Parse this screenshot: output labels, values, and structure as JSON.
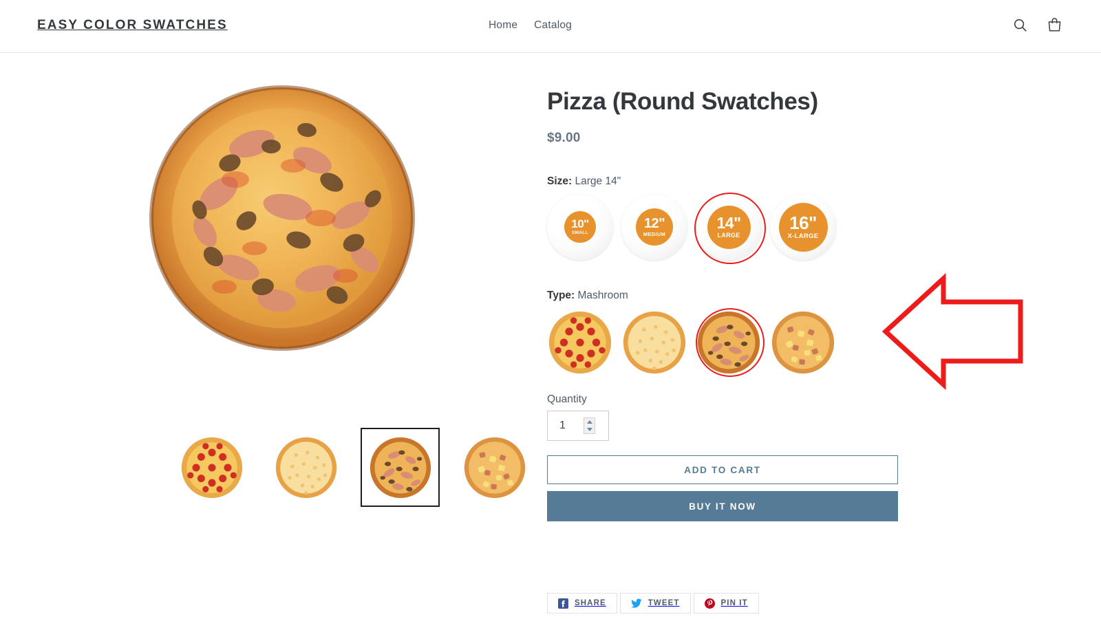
{
  "header": {
    "brand": "EASY COLOR SWATCHES",
    "nav": [
      {
        "label": "Home",
        "name": "nav-link-home"
      },
      {
        "label": "Catalog",
        "name": "nav-link-catalog"
      }
    ],
    "icons": [
      {
        "name": "search-icon",
        "label": "Search"
      },
      {
        "name": "cart-icon",
        "label": "Cart"
      }
    ]
  },
  "product": {
    "title": "Pizza (Round Swatches)",
    "price": "$9.00",
    "featured_image_alt": "Mushroom and ham pizza",
    "thumbnails": [
      {
        "alt": "Pepperoni pizza",
        "selected": false
      },
      {
        "alt": "Cheese pizza",
        "selected": false
      },
      {
        "alt": "Mushroom pizza",
        "selected": true
      },
      {
        "alt": "Hawaiian pizza",
        "selected": false
      }
    ]
  },
  "options": {
    "size": {
      "label": "Size:",
      "selected_value": "Large 14\"",
      "swatches": [
        {
          "number": "10\"",
          "caption": "SMALL",
          "selected": false
        },
        {
          "number": "12\"",
          "caption": "MEDIUM",
          "selected": false
        },
        {
          "number": "14\"",
          "caption": "LARGE",
          "selected": true
        },
        {
          "number": "16\"",
          "caption": "X-LARGE",
          "selected": false
        }
      ]
    },
    "type": {
      "label": "Type:",
      "selected_value": "Mashroom",
      "swatches": [
        {
          "alt": "Pepperoni",
          "selected": false
        },
        {
          "alt": "Cheese",
          "selected": false
        },
        {
          "alt": "Mashroom",
          "selected": true
        },
        {
          "alt": "Hawaiian",
          "selected": false
        }
      ]
    }
  },
  "quantity": {
    "label": "Quantity",
    "value": "1"
  },
  "actions": {
    "add_to_cart": "ADD TO CART",
    "buy_it_now": "BUY IT NOW"
  },
  "share": [
    {
      "label": "SHARE",
      "name": "share-facebook-button",
      "icon": "facebook-icon",
      "color": "#3b5998"
    },
    {
      "label": "TWEET",
      "name": "share-twitter-button",
      "icon": "twitter-icon",
      "color": "#1da1f2"
    },
    {
      "label": "PIN IT",
      "name": "share-pinterest-button",
      "icon": "pinterest-icon",
      "color": "#bd081c"
    }
  ],
  "annotation": {
    "arrow_color": "#ee1b1b",
    "direction": "left"
  },
  "colors": {
    "swatch_orange": "#e8922e",
    "selection_red": "#ee1b1b",
    "accent_blue": "#557b96",
    "text_dark": "#33383c"
  }
}
